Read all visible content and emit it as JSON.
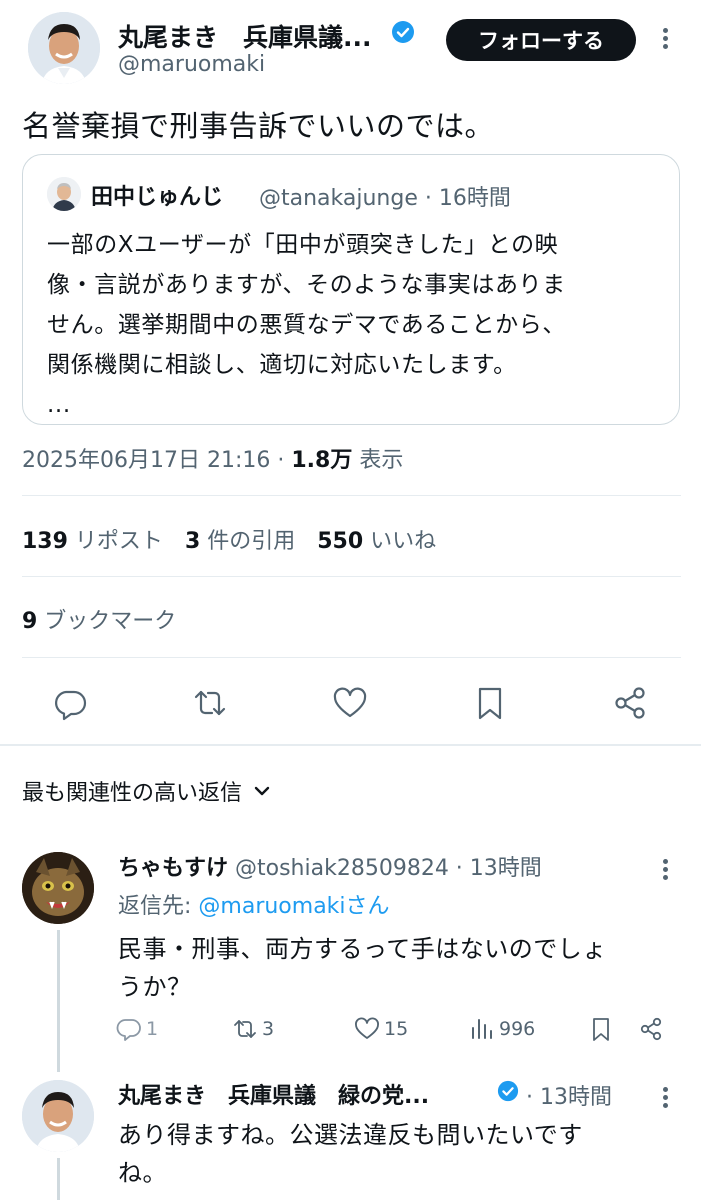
{
  "tweet": {
    "author_name": "丸尾まき　兵庫県議...",
    "author_handle": "@maruomaki",
    "follow_label": "フォローする",
    "text": "名誉棄損で刑事告訴でいいのでは。",
    "quote": {
      "name": "田中じゅんじ",
      "handle_time": "@tanakajunge · 16時間",
      "lines": [
        "一部のXユーザーが「田中が頭突きした」との映",
        "像・言説がありますが、そのような事実はありま",
        "せん。選挙期間中の悪質なデマであることから、",
        "関係機関に相談し、適切に対応いたします。",
        "..."
      ]
    },
    "datetime": "2025年06月17日 21:16 · ",
    "views_count": "1.8万",
    "views_label": " 表示",
    "stats": {
      "reposts_count": "139",
      "reposts_label": " リポスト",
      "quotes_count": "3",
      "quotes_label": " 件の引用",
      "likes_count": "550",
      "likes_label": " いいね",
      "bookmarks_count": "9",
      "bookmarks_label": " ブックマーク"
    }
  },
  "relevant_replies_label": "最も関連性の高い返信",
  "replies": [
    {
      "name": "ちゃもすけ",
      "handle_time": " @toshiak28509824 · 13時間",
      "reply_to_prefix": "返信先: ",
      "reply_to_mention": "@maruomakiさん",
      "lines": [
        "民事・刑事、両方するって手はないのでしょ",
        "うか？"
      ],
      "reply_count": "1",
      "repost_count": "3",
      "like_count": "15",
      "view_count": "996"
    },
    {
      "name": "丸尾まき　兵庫県議　緑の党...",
      "time": "· 13時間",
      "lines": [
        "あり得ますね。公選法違反も問いたいです",
        "ね。"
      ]
    }
  ],
  "colors": {
    "text": "#0f1419",
    "secondary": "#536471",
    "accent": "#1d9bf0",
    "border": "#cfd9de"
  }
}
